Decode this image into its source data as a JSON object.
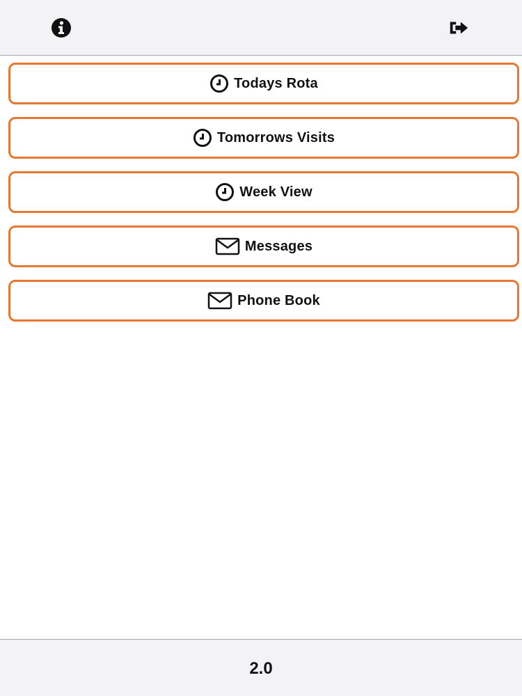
{
  "header": {
    "info_icon": "info-circle-icon",
    "logout_icon": "sign-out-icon"
  },
  "menu": {
    "accent_color": "#e8782f",
    "items": [
      {
        "label": "Todays Rota",
        "icon": "clock-icon"
      },
      {
        "label": "Tomorrows Visits",
        "icon": "clock-icon"
      },
      {
        "label": "Week View",
        "icon": "clock-icon"
      },
      {
        "label": "Messages",
        "icon": "envelope-icon"
      },
      {
        "label": "Phone Book",
        "icon": "envelope-icon"
      }
    ]
  },
  "footer": {
    "version": "2.0"
  }
}
